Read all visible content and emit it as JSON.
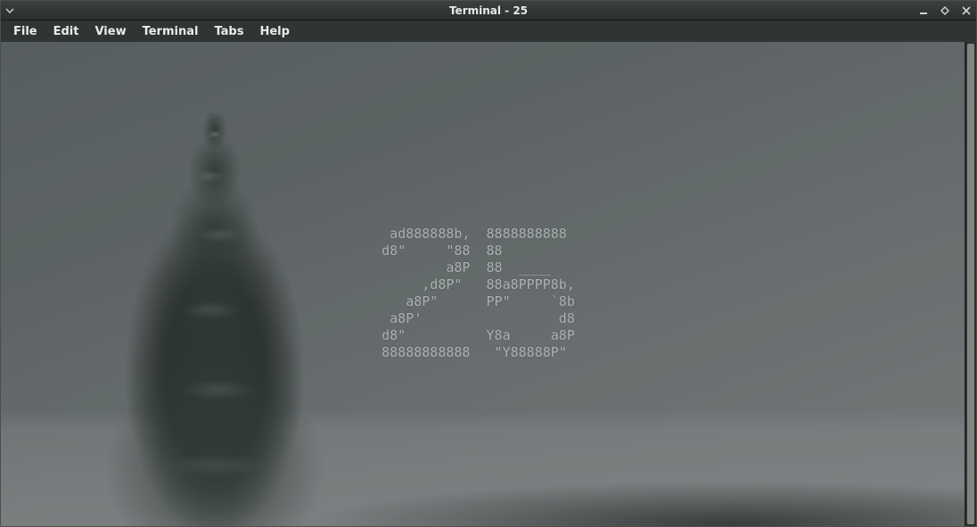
{
  "titlebar": {
    "title": "Terminal - 25"
  },
  "menu": {
    "items": [
      {
        "label": "File"
      },
      {
        "label": "Edit"
      },
      {
        "label": "View"
      },
      {
        "label": "Terminal"
      },
      {
        "label": "Tabs"
      },
      {
        "label": "Help"
      }
    ]
  },
  "terminal": {
    "ascii_art": " ad888888b,  8888888888  \nd8\"     \"88  88          \n        a8P  88  ____    \n     ,d8P\"   88a8PPPP8b, \n   a8P\"      PP\"     `8b \n a8P'                 d8 \nd8\"          Y8a     a8P \n88888888888   \"Y88888P\"  "
  },
  "icons": {
    "app_menu": "chevron-down",
    "minimize": "minimize",
    "maximize": "maximize",
    "close": "close"
  }
}
